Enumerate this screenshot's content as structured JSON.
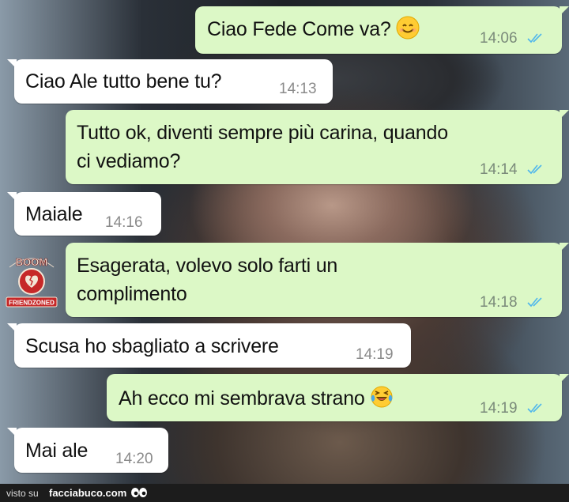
{
  "messages": [
    {
      "dir": "out",
      "text": "Ciao Fede Come va?",
      "emoji": "smile-emoji",
      "time": "14:06"
    },
    {
      "dir": "in",
      "text": "Ciao Ale tutto bene tu?",
      "time": "14:13"
    },
    {
      "dir": "out",
      "line1": "Tutto ok, diventi sempre più carina, quando",
      "line2": "ci vediamo?",
      "time": "14:14"
    },
    {
      "dir": "in",
      "text": "Maiale",
      "time": "14:16"
    },
    {
      "dir": "out",
      "line1": "Esagerata, volevo solo farti un",
      "line2": "complimento",
      "time": "14:18"
    },
    {
      "dir": "in",
      "text": "Scusa ho sbagliato a scrivere",
      "time": "14:19"
    },
    {
      "dir": "out",
      "text": "Ah ecco mi sembrava strano",
      "emoji": "laughing-tears-emoji",
      "time": "14:19"
    },
    {
      "dir": "in",
      "text": "Mai ale",
      "time": "14:20"
    }
  ],
  "watermark": {
    "top": "BOOM",
    "bottom": "FRIENDZONED"
  },
  "footer": {
    "visto": "visto su",
    "site": "facciabuco.com"
  },
  "colors": {
    "outgoing": "#dcf8c6",
    "incoming": "#ffffff",
    "tick": "#4fb6ec"
  }
}
